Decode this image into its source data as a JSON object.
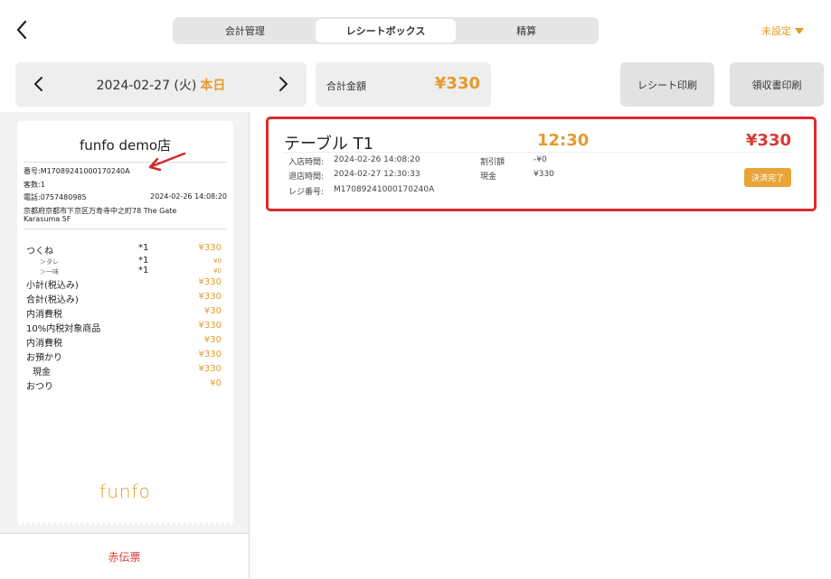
{
  "header": {
    "tabs": [
      "会計管理",
      "レシートボックス",
      "精算"
    ],
    "active_tab": 1,
    "unset_label": "未設定"
  },
  "toolbar": {
    "date": "2024-02-27 (火)",
    "today": "本日",
    "total_label": "合計金額",
    "total_value": "¥330",
    "print_receipt": "レシート印刷",
    "print_ryoshu": "領収書印刷"
  },
  "receipt": {
    "shop": "funfo demo店",
    "number": "番号:M17089241000170240A",
    "guests": "客数:1",
    "phone": "電話:0757480985",
    "datetime": "2024-02-26 14:08:20",
    "address1": "京都府京都市下京区万寿寺中之町78 The Gate",
    "address2": "Karasuma 5F",
    "items": [
      {
        "name": "つくね",
        "qty": "*1",
        "price": "¥330",
        "type": "main"
      },
      {
        "name": "＞タレ",
        "qty": "*1",
        "price": "¥0",
        "type": "sub"
      },
      {
        "name": "＞一味",
        "qty": "*1",
        "price": "¥0",
        "type": "sub"
      },
      {
        "name": "小計(税込み)",
        "qty": "",
        "price": "¥330",
        "type": "main"
      },
      {
        "name": "合計(税込み)",
        "qty": "",
        "price": "¥330",
        "type": "main"
      },
      {
        "name": "内消費税",
        "qty": "",
        "price": "¥30",
        "type": "main"
      },
      {
        "name": "10%内税対象商品",
        "qty": "",
        "price": "¥330",
        "type": "main"
      },
      {
        "name": "内消費税",
        "qty": "",
        "price": "¥30",
        "type": "main"
      },
      {
        "name": "お預かり",
        "qty": "",
        "price": "¥330",
        "type": "main"
      },
      {
        "name": "現金",
        "qty": "",
        "price": "¥330",
        "type": "ind"
      },
      {
        "name": "おつり",
        "qty": "",
        "price": "¥0",
        "type": "main"
      }
    ],
    "logo": "funfo",
    "akaden": "赤伝票"
  },
  "order": {
    "table": "テーブル T1",
    "time": "12:30",
    "price": "¥330",
    "enter_label": "入店時間:",
    "enter_value": "2024-02-26 14:08:20",
    "exit_label": "退店時間:",
    "exit_value": "2024-02-27 12:30:33",
    "register_label": "レジ番号:",
    "register_value": "M17089241000170240A",
    "discount_label": "割引額",
    "discount_value": "-¥0",
    "cash_label": "現金",
    "cash_value": "¥330",
    "status": "決済完了"
  },
  "colors": {
    "accent": "#e49b2a",
    "red": "#d93a36",
    "highlight": "#e0282a"
  }
}
